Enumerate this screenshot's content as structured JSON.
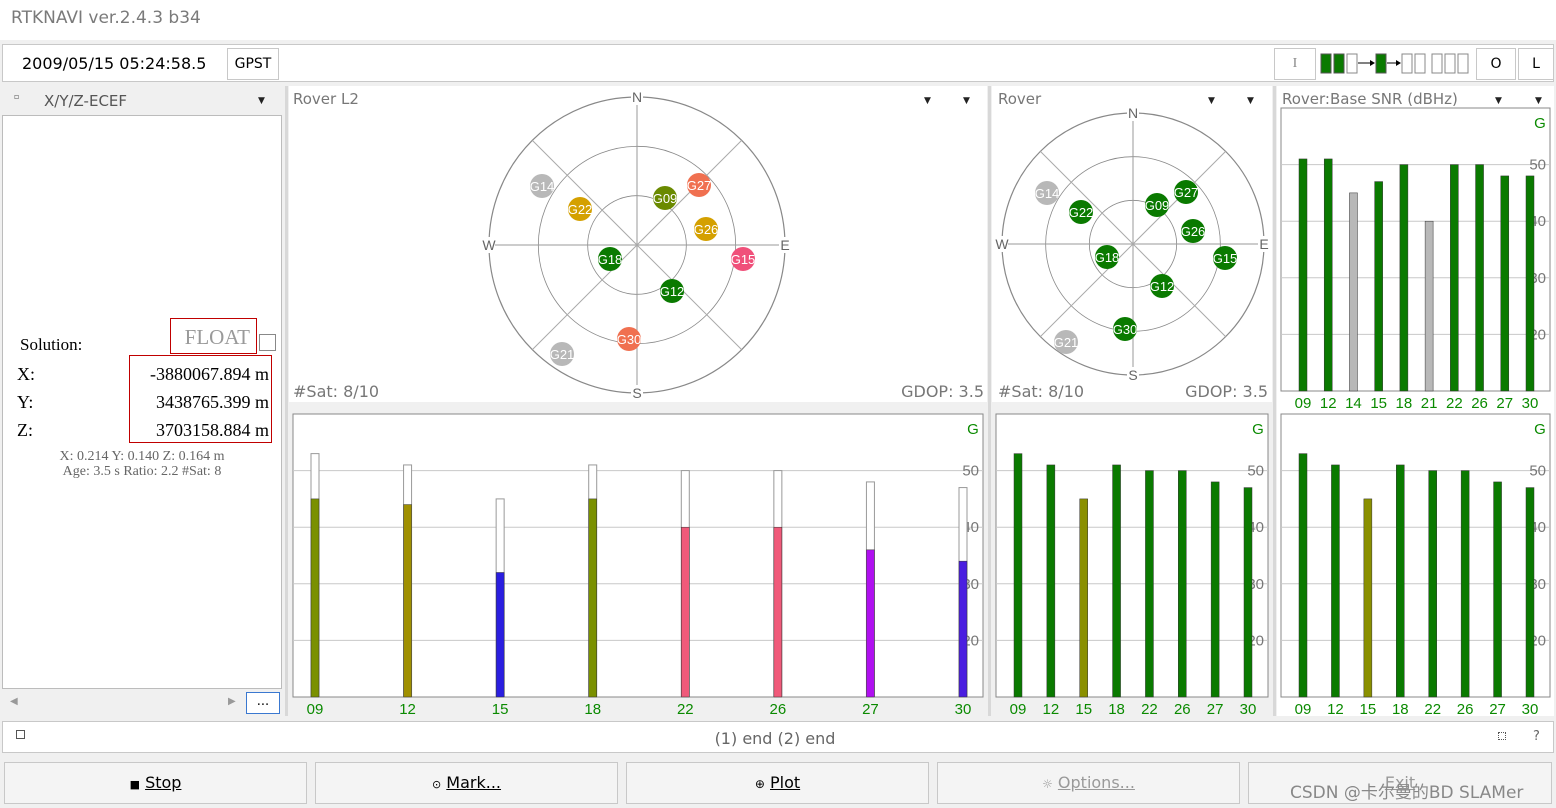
{
  "app": {
    "title": "RTKNAVI ver.2.4.3 b34"
  },
  "toolbar": {
    "datetime": "2009/05/15 05:24:58.5",
    "time_system": "GPST",
    "btn_i": "I",
    "btn_o": "O",
    "btn_l": "L"
  },
  "left": {
    "format_select": "X/Y/Z-ECEF",
    "solution_label": "Solution:",
    "solution_status": "FLOAT",
    "x_label": "X:",
    "x_value": "-3880067.894 m",
    "y_label": "Y:",
    "y_value": "3438765.399 m",
    "z_label": "Z:",
    "z_value": "3703158.884 m",
    "stats1": "X: 0.214 Y: 0.140 Z: 0.164 m",
    "stats2": "Age: 3.5 s Ratio: 2.2 #Sat: 8",
    "more_btn": "..."
  },
  "panel1": {
    "title": "Rover L2",
    "sat_count": "#Sat: 8/10",
    "gdop": "GDOP: 3.5",
    "snr_label": "G"
  },
  "panel2": {
    "title": "Rover",
    "sat_count": "#Sat: 8/10",
    "gdop": "GDOP: 3.5",
    "snr_label": "G"
  },
  "panel3": {
    "title": "Rover:Base  SNR (dBHz)",
    "snr_label": "G",
    "snr_label2": "G"
  },
  "compass": {
    "n": "N",
    "s": "S",
    "e": "E",
    "w": "W"
  },
  "skyplot1_sats": [
    {
      "id": "G14",
      "color": "#b8b8b8"
    },
    {
      "id": "G22",
      "color": "#d4a000"
    },
    {
      "id": "G09",
      "color": "#6a8a00"
    },
    {
      "id": "G27",
      "color": "#f07050"
    },
    {
      "id": "G26",
      "color": "#d4a000"
    },
    {
      "id": "G18",
      "color": "#0a7a00"
    },
    {
      "id": "G15",
      "color": "#f0507a"
    },
    {
      "id": "G12",
      "color": "#0a7a00"
    },
    {
      "id": "G30",
      "color": "#f07050"
    },
    {
      "id": "G21",
      "color": "#b8b8b8"
    }
  ],
  "skyplot2_sats": [
    {
      "id": "G14",
      "color": "#b8b8b8"
    },
    {
      "id": "G22",
      "color": "#0a7a00"
    },
    {
      "id": "G09",
      "color": "#0a7a00"
    },
    {
      "id": "G27",
      "color": "#0a7a00"
    },
    {
      "id": "G26",
      "color": "#0a7a00"
    },
    {
      "id": "G18",
      "color": "#0a7a00"
    },
    {
      "id": "G15",
      "color": "#0a7a00"
    },
    {
      "id": "G12",
      "color": "#0a7a00"
    },
    {
      "id": "G30",
      "color": "#0a7a00"
    },
    {
      "id": "G21",
      "color": "#b8b8b8"
    }
  ],
  "snr_axis": {
    "ticks": [
      "50",
      "40",
      "30",
      "20"
    ]
  },
  "snr1": {
    "sats": [
      "09",
      "12",
      "15",
      "18",
      "22",
      "26",
      "27",
      "30"
    ],
    "values": [
      45,
      44,
      32,
      45,
      40,
      40,
      36,
      34
    ],
    "max": [
      53,
      51,
      45,
      51,
      50,
      50,
      48,
      47
    ],
    "colors": [
      "#7a9000",
      "#a09000",
      "#2a1ee0",
      "#7a9000",
      "#f05a7a",
      "#f05a7a",
      "#b010f0",
      "#4a1ee0"
    ]
  },
  "snr2": {
    "sats": [
      "09",
      "12",
      "15",
      "18",
      "22",
      "26",
      "27",
      "30"
    ],
    "values": [
      53,
      51,
      45,
      51,
      50,
      50,
      48,
      47
    ],
    "colors": [
      "#0a7a00",
      "#0a7a00",
      "#8a9000",
      "#0a7a00",
      "#0a7a00",
      "#0a7a00",
      "#0a7a00",
      "#0a7a00"
    ]
  },
  "snr3a": {
    "sats": [
      "09",
      "12",
      "14",
      "15",
      "18",
      "21",
      "22",
      "26",
      "27",
      "30"
    ],
    "values": [
      51,
      51,
      45,
      47,
      50,
      40,
      50,
      50,
      48,
      48
    ],
    "colors": [
      "#0a7a00",
      "#0a7a00",
      "#b8b8b8",
      "#0a7a00",
      "#0a7a00",
      "#b8b8b8",
      "#0a7a00",
      "#0a7a00",
      "#0a7a00",
      "#0a7a00"
    ]
  },
  "snr3b": {
    "sats": [
      "09",
      "12",
      "15",
      "18",
      "22",
      "26",
      "27",
      "30"
    ],
    "values": [
      53,
      51,
      45,
      51,
      50,
      50,
      48,
      47
    ],
    "colors": [
      "#0a7a00",
      "#0a7a00",
      "#8a9000",
      "#0a7a00",
      "#0a7a00",
      "#0a7a00",
      "#0a7a00",
      "#0a7a00"
    ]
  },
  "status_bar": {
    "message": "(1) end (2) end",
    "help": "?"
  },
  "buttons": {
    "stop": "Stop",
    "mark": "Mark...",
    "plot": "Plot",
    "options": "Options...",
    "exit": "Exit"
  },
  "watermark": "CSDN @卡尔曼的BD SLAMer"
}
